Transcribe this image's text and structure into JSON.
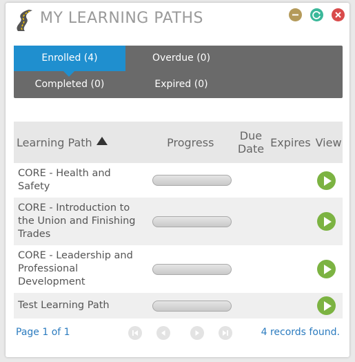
{
  "header": {
    "title": "MY LEARNING PATHS",
    "logo_icon": "road-icon",
    "controls": [
      {
        "name": "minimize",
        "icon": "minus-icon",
        "color": "#b49a5a"
      },
      {
        "name": "refresh",
        "icon": "refresh-icon",
        "color": "#3bb89a"
      },
      {
        "name": "close",
        "icon": "close-icon",
        "color": "#d94b4b"
      }
    ]
  },
  "tabs": {
    "enrolled": "Enrolled (4)",
    "overdue": "Overdue (0)",
    "completed": "Completed (0)",
    "expired": "Expired (0)",
    "active": "enrolled",
    "active_color": "#1f8fcf"
  },
  "table": {
    "columns": {
      "path": "Learning Path",
      "progress": "Progress",
      "due": "Due Date",
      "expires": "Expires",
      "view": "View"
    },
    "sort": {
      "column": "path",
      "direction": "ascending",
      "icon": "sort-up-icon"
    },
    "rows": [
      {
        "path": "CORE - Health and Safety",
        "progress": 0,
        "due": "",
        "expires": ""
      },
      {
        "path": "CORE - Introduction to the Union and Finishing Trades",
        "progress": 0,
        "due": "",
        "expires": ""
      },
      {
        "path": "CORE - Leadership and Professional Development",
        "progress": 0,
        "due": "",
        "expires": ""
      },
      {
        "path": "Test Learning Path",
        "progress": 0,
        "due": "",
        "expires": ""
      }
    ]
  },
  "footer": {
    "page_info": "Page 1 of 1",
    "records": "4 records found.",
    "pager": [
      "first-page-icon",
      "previous-page-icon",
      "next-page-icon",
      "last-page-icon"
    ]
  },
  "colors": {
    "link": "#2b7bbf",
    "play": "#7cb342"
  }
}
